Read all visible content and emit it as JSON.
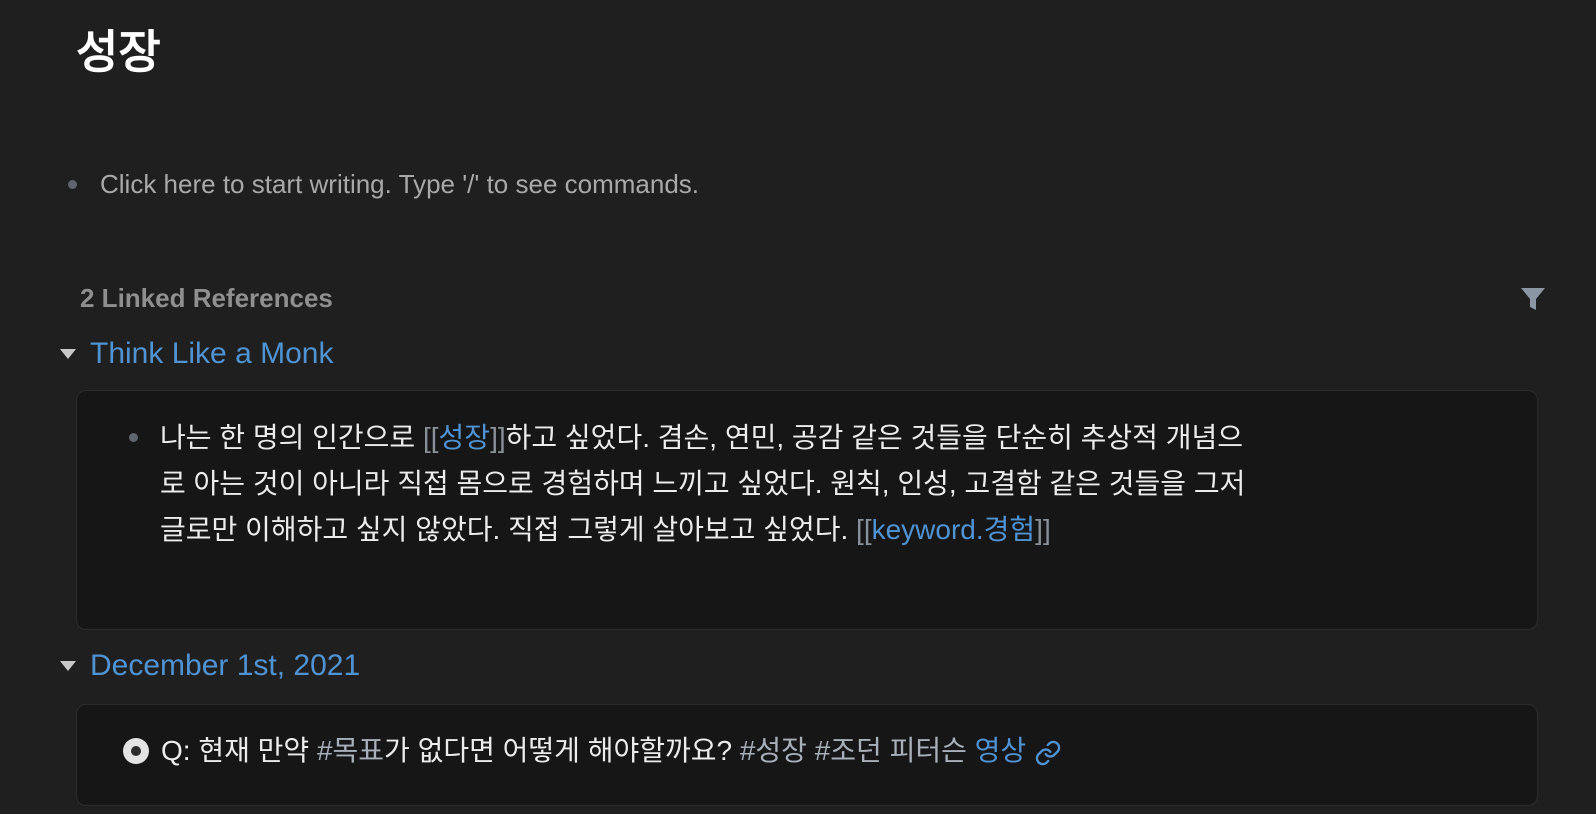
{
  "page": {
    "title": "성장",
    "placeholder": "Click here to start writing. Type '/' to see commands."
  },
  "linked_references": {
    "header": "2 Linked References",
    "filter_icon": "filter-icon",
    "groups": [
      {
        "title": "Think Like a Monk",
        "block": {
          "text_1": "나는 한 명의 인간으로 ",
          "bracket_open": "[[",
          "link_1": "성장",
          "bracket_close": "]]",
          "text_2": "하고 싶었다. 겸손, 연민, 공감 같은 것들을 단순히 추상적 개념으로 아는 것이 아니라 직접 몸으로 경험하며 느끼고 싶었다. 원칙, 인성, 고결함 같은 것들을 그저 글로만 이해하고 싶지 않았다. 직접 그렇게 살아보고 싶었다. ",
          "bracket_open_2": "[[",
          "link_2": "keyword.경험",
          "bracket_close_2": "]]"
        }
      },
      {
        "title": "December 1st, 2021",
        "block": {
          "text_1": "Q: 현재 만약 ",
          "tag_1": "#목표",
          "text_2": "가 없다면 어떻게 해야할까요? ",
          "tag_2": "#성장",
          "tag_3": "#조던 피터슨",
          "link_1": "영상",
          "link_icon": "link-icon"
        }
      }
    ]
  }
}
